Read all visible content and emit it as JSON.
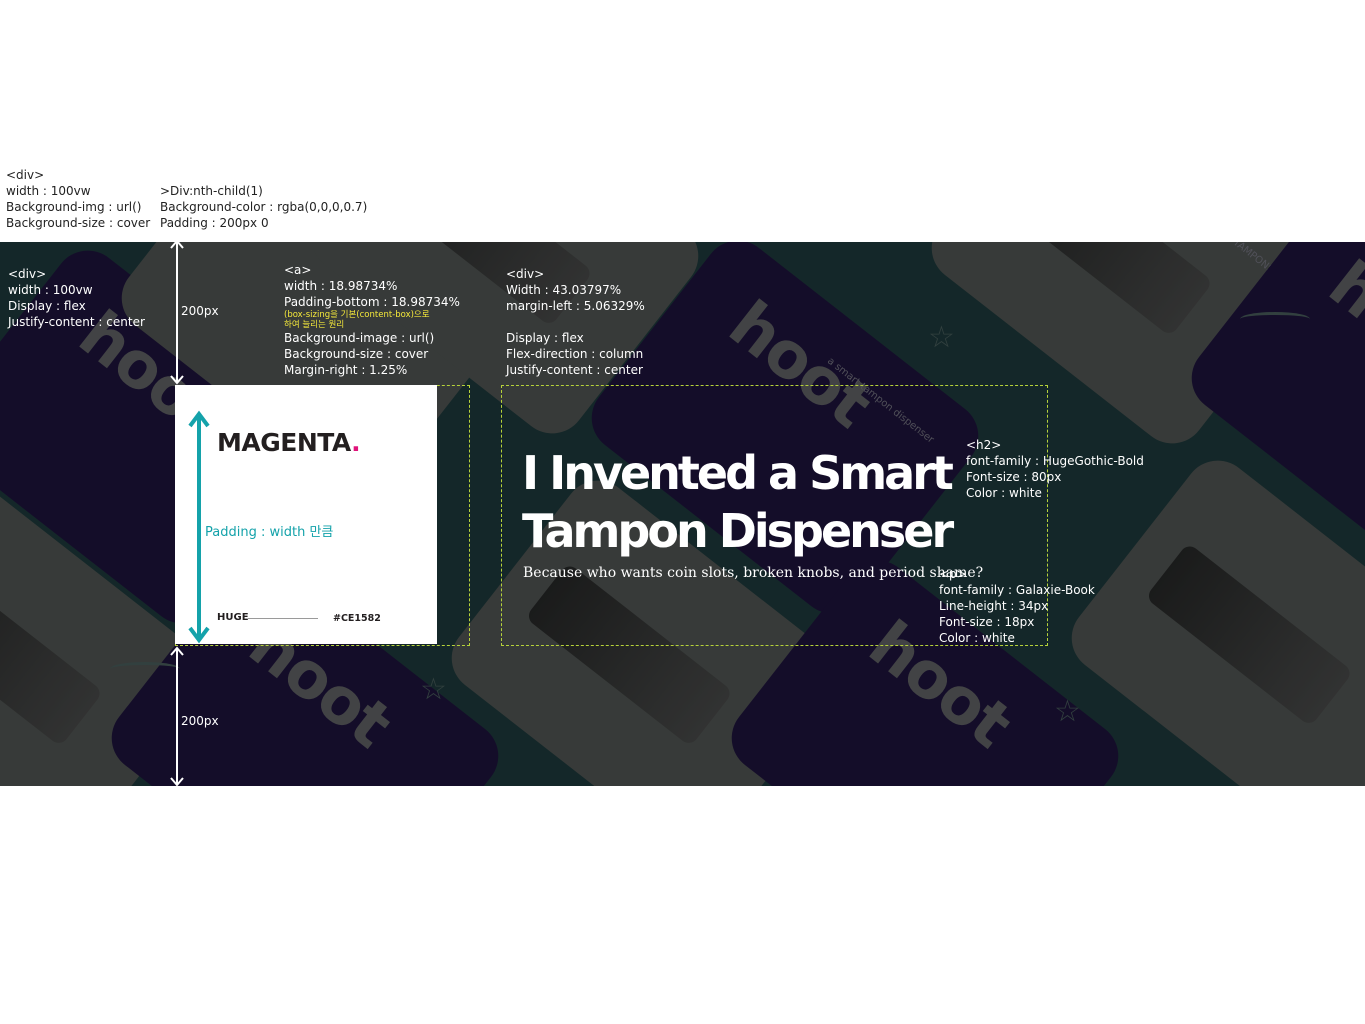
{
  "annotations": {
    "outer_div": [
      "<div>",
      "width : 100vw",
      "Background-img : url()",
      "Background-size : cover"
    ],
    "nth_child": [
      ">Div:nth-child(1)",
      "Background-color : rgba(0,0,0,0.7)",
      "Padding : 200px  0"
    ],
    "flex_div": [
      "<div>",
      "width : 100vw",
      "Display : flex",
      "Justify-content : center"
    ],
    "anchor": {
      "tag": "<a>",
      "width": "width : 18.98734%",
      "padding_bottom": "Padding-bottom  : 18.98734%",
      "note_line1": "(box-sizing을 기본(content-box)으로",
      "note_line2": "하여 늘리는 원리",
      "bg_image": "Background-image : url()",
      "bg_size": "Background-size : cover",
      "margin_right": "Margin-right : 1.25%"
    },
    "text_div": [
      "<div>",
      "Width : 43.03797%",
      "margin-left : 5.06329%",
      "",
      "Display : flex",
      "Flex-direction  : column",
      "Justify-content  : center"
    ],
    "h2": [
      "<h2>",
      "font-family  : HugeGothic-Bold",
      "Font-size  : 80px",
      "Color : white"
    ],
    "p": [
      "<p>",
      "font-family  : Galaxie-Book",
      "Line-height : 34px",
      "Font-size  : 18px",
      "Color : white"
    ],
    "padding_top_label": "200px",
    "padding_bottom_label": "200px",
    "padding_width_label": "Padding : width 만큼"
  },
  "card": {
    "brand": "MAGENTA",
    "brand_dot": ".",
    "agency": "HUGE",
    "hex": "#CE1582"
  },
  "hero": {
    "headline": "I Invented a Smart Tampon Dispenser",
    "subline": "Because who wants coin slots, broken knobs, and period shame?"
  },
  "background_art": {
    "logo_text": "hoot",
    "product_text": "a smart tampon dispenser",
    "free_text": "FREE TAMPONS"
  },
  "colors": {
    "hero_bg": "#1f3d3f",
    "accent": "#e0137a",
    "annotation_teal": "#14a2aa",
    "outline": "#b6d23a"
  }
}
